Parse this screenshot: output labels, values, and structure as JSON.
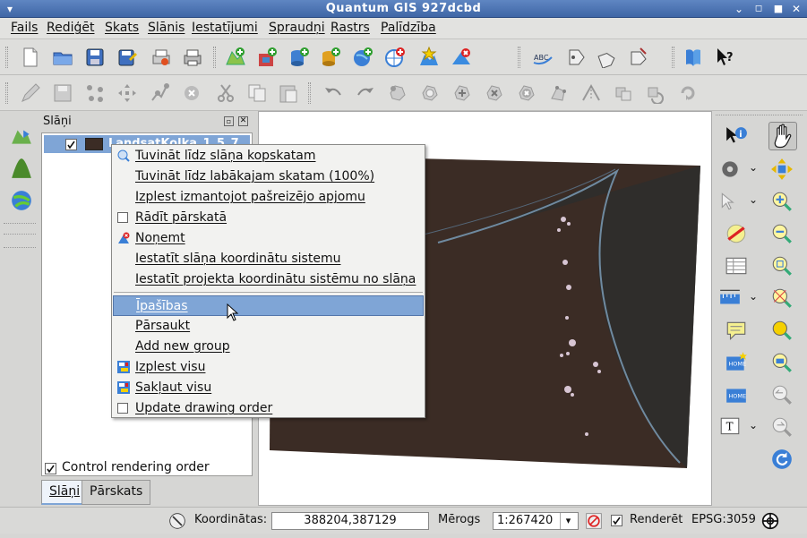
{
  "window": {
    "title": "Quantum GIS 927dcbd"
  },
  "menubar": {
    "items": [
      "Fails",
      "Rediģēt",
      "Skats",
      "Slānis",
      "Iestatījumi",
      "Spraudņi",
      "Rastrs",
      "Palīdzība"
    ]
  },
  "layers_panel": {
    "title": "Slāņi",
    "layer": {
      "name": "LandsatKolka_1_5_7",
      "checked": true
    },
    "control_rendering_order": {
      "label": "Control rendering order",
      "checked": true
    },
    "tabs": [
      "Slāņi",
      "Pārskats"
    ]
  },
  "context_menu": {
    "items": [
      {
        "label": "Tuvināt līdz slāņa kopskatam",
        "icon": "zoom-layer-icon"
      },
      {
        "label": "Tuvināt līdz labākajam skatam (100%)",
        "icon": ""
      },
      {
        "label": "Izplest izmantojot pašreizējo apjomu",
        "icon": ""
      },
      {
        "label": "Rādīt pārskatā",
        "icon": "checkbox-icon"
      },
      {
        "label": "Noņemt",
        "icon": "remove-icon"
      },
      {
        "label": "Iestatīt slāņa koordinātu sistemu",
        "icon": ""
      },
      {
        "label": "Iestatīt projekta koordinātu sistēmu no slāņa",
        "icon": ""
      },
      {
        "label": "Īpašības",
        "icon": "",
        "selected": true
      },
      {
        "label": "Pārsaukt",
        "icon": ""
      },
      {
        "label": "Add new group",
        "icon": ""
      },
      {
        "label": "Izplest visu",
        "icon": "expand-icon"
      },
      {
        "label": "Sakļaut visu",
        "icon": "collapse-icon"
      },
      {
        "label": "Update drawing order",
        "icon": "checkbox-icon"
      }
    ]
  },
  "statusbar": {
    "coords_label": "Koordinātas:",
    "coords_value": "388204,387129",
    "scale_label": "Mērogs",
    "scale_value": "1:267420",
    "render_label": "Renderēt",
    "render_checked": true,
    "crs": "EPSG:3059"
  },
  "colors": {
    "selection": "#7fa5d6",
    "titlebar": "#4a72b2",
    "raster": "#3b2c25"
  }
}
